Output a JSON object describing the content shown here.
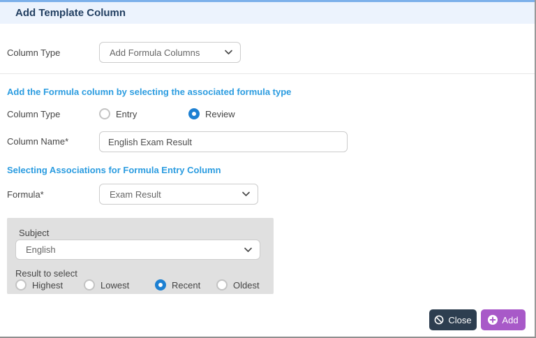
{
  "header": {
    "title": "Add Template Column"
  },
  "colors": {
    "header_bg": "#ecf3fd",
    "top_accent": "#7cb0ea",
    "section_heading_blue": "#2b9ce0",
    "radio_selected_blue": "#1d80d2",
    "close_button_bg": "#2d3e50",
    "add_button_bg": "#a859c8",
    "panel_bg": "#e0e0e0"
  },
  "form": {
    "column_type_top": {
      "label": "Column Type",
      "value": "Add Formula Columns"
    },
    "section1_heading": "Add the Formula column by selecting the associated formula type",
    "column_type_radio": {
      "label": "Column Type",
      "options": [
        {
          "label": "Entry",
          "selected": false
        },
        {
          "label": "Review",
          "selected": true
        }
      ]
    },
    "column_name": {
      "label": "Column Name*",
      "value": "English Exam Result"
    },
    "section2_heading": "Selecting Associations for Formula Entry Column",
    "formula": {
      "label": "Formula*",
      "value": "Exam Result"
    },
    "association_panel": {
      "subject": {
        "label": "Subject",
        "value": "English"
      },
      "result_to_select": {
        "label": "Result to select",
        "options": [
          {
            "label": "Highest",
            "selected": false
          },
          {
            "label": "Lowest",
            "selected": false
          },
          {
            "label": "Recent",
            "selected": true
          },
          {
            "label": "Oldest",
            "selected": false
          }
        ]
      }
    }
  },
  "footer": {
    "close_label": "Close",
    "add_label": "Add"
  }
}
